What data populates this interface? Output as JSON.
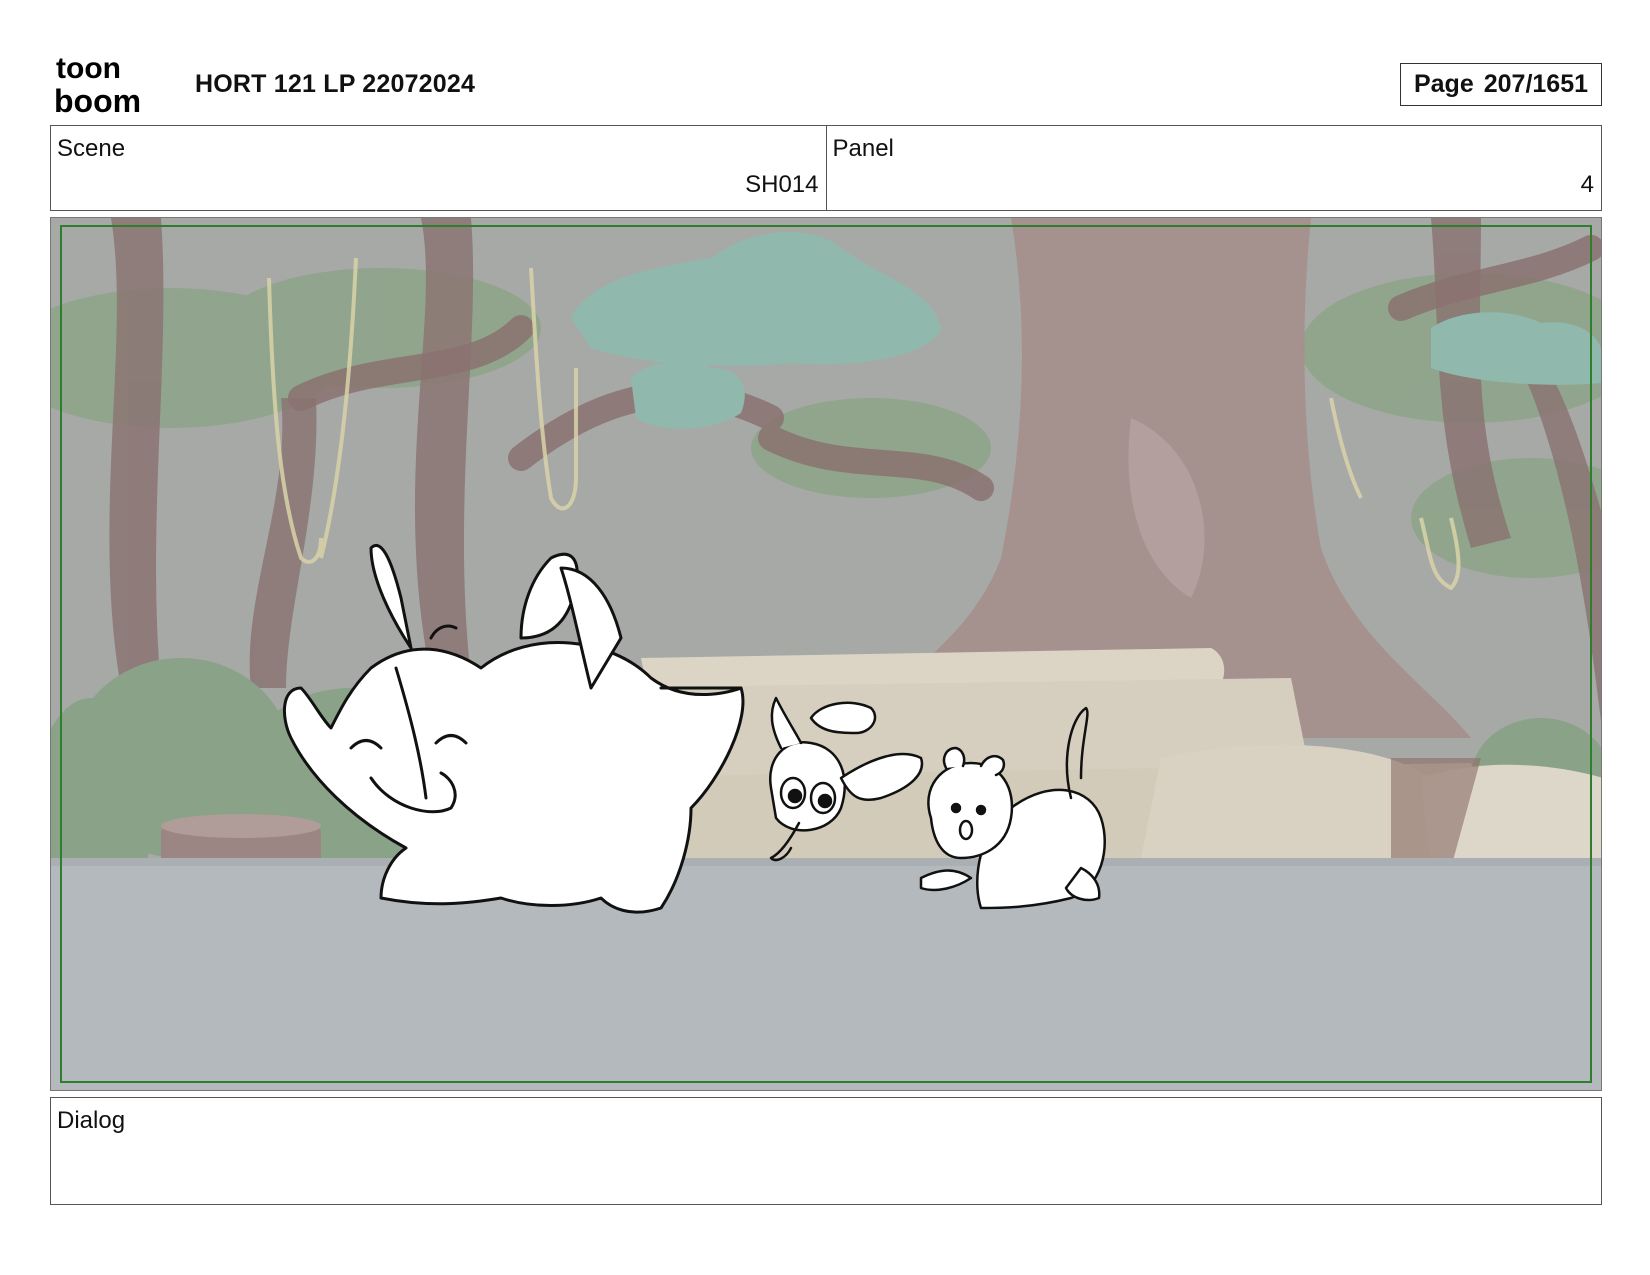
{
  "header": {
    "logo_line1": "toon",
    "logo_line2": "boom",
    "title": "HORT 121 LP 22072024",
    "page_label": "Page",
    "page_value": "207/1651"
  },
  "info": {
    "scene_label": "Scene",
    "scene_value": "SH014",
    "panel_label": "Panel",
    "panel_value": "4"
  },
  "dialog": {
    "label": "Dialog",
    "text": ""
  },
  "colors": {
    "safe_frame": "#2f7d2f",
    "background_trunk": "#8e7a78",
    "foliage": "#8aa287",
    "canopy": "#8fb3a8",
    "ground": "#b3b9bc",
    "rock": "#dcd6c8"
  }
}
